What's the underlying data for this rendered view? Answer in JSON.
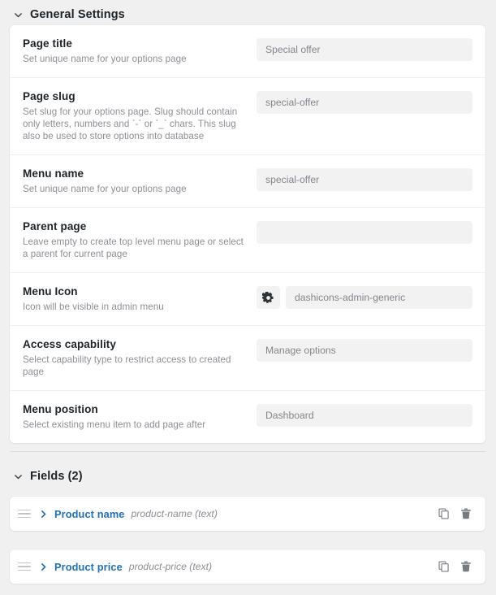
{
  "general": {
    "header": "General Settings",
    "collapse_icon": "chevron-down-icon",
    "rows": [
      {
        "label": "Page title",
        "desc": "Set unique name for your options page",
        "value": "Special offer"
      },
      {
        "label": "Page slug",
        "desc": "Set slug for your options page. Slug should contain only letters, numbers and `-` or `_` chars. This slug also be used to store options into database",
        "value": "special-offer"
      },
      {
        "label": "Menu name",
        "desc": "Set unique name for your options page",
        "value": "special-offer"
      },
      {
        "label": "Parent page",
        "desc": "Leave empty to create top level menu page or select a parent for current page",
        "value": ""
      },
      {
        "label": "Menu Icon",
        "desc": "Icon will be visible in admin menu",
        "value": "dashicons-admin-generic",
        "icon": "gear-icon"
      },
      {
        "label": "Access capability",
        "desc": "Select capability type to restrict access to created page",
        "value": "Manage options"
      },
      {
        "label": "Menu position",
        "desc": "Select existing menu item to add page after",
        "value": "Dashboard"
      }
    ]
  },
  "fields": {
    "header": "Fields (2)",
    "collapse_icon": "chevron-down-icon",
    "items": [
      {
        "title": "Product name",
        "meta": "product-name (text)",
        "drag_icon": "drag-handle-icon",
        "expand_icon": "chevron-right-icon",
        "duplicate_icon": "copy-icon",
        "delete_icon": "trash-icon"
      },
      {
        "title": "Product price",
        "meta": "product-price (text)",
        "drag_icon": "drag-handle-icon",
        "expand_icon": "chevron-right-icon",
        "duplicate_icon": "copy-icon",
        "delete_icon": "trash-icon"
      }
    ]
  },
  "colors": {
    "background": "#f0f0f1",
    "card": "#ffffff",
    "input": "#f2f2f3",
    "label": "#1d2327",
    "muted": "#8c8f94",
    "link": "#2271b1",
    "divider": "#dcdcde"
  }
}
